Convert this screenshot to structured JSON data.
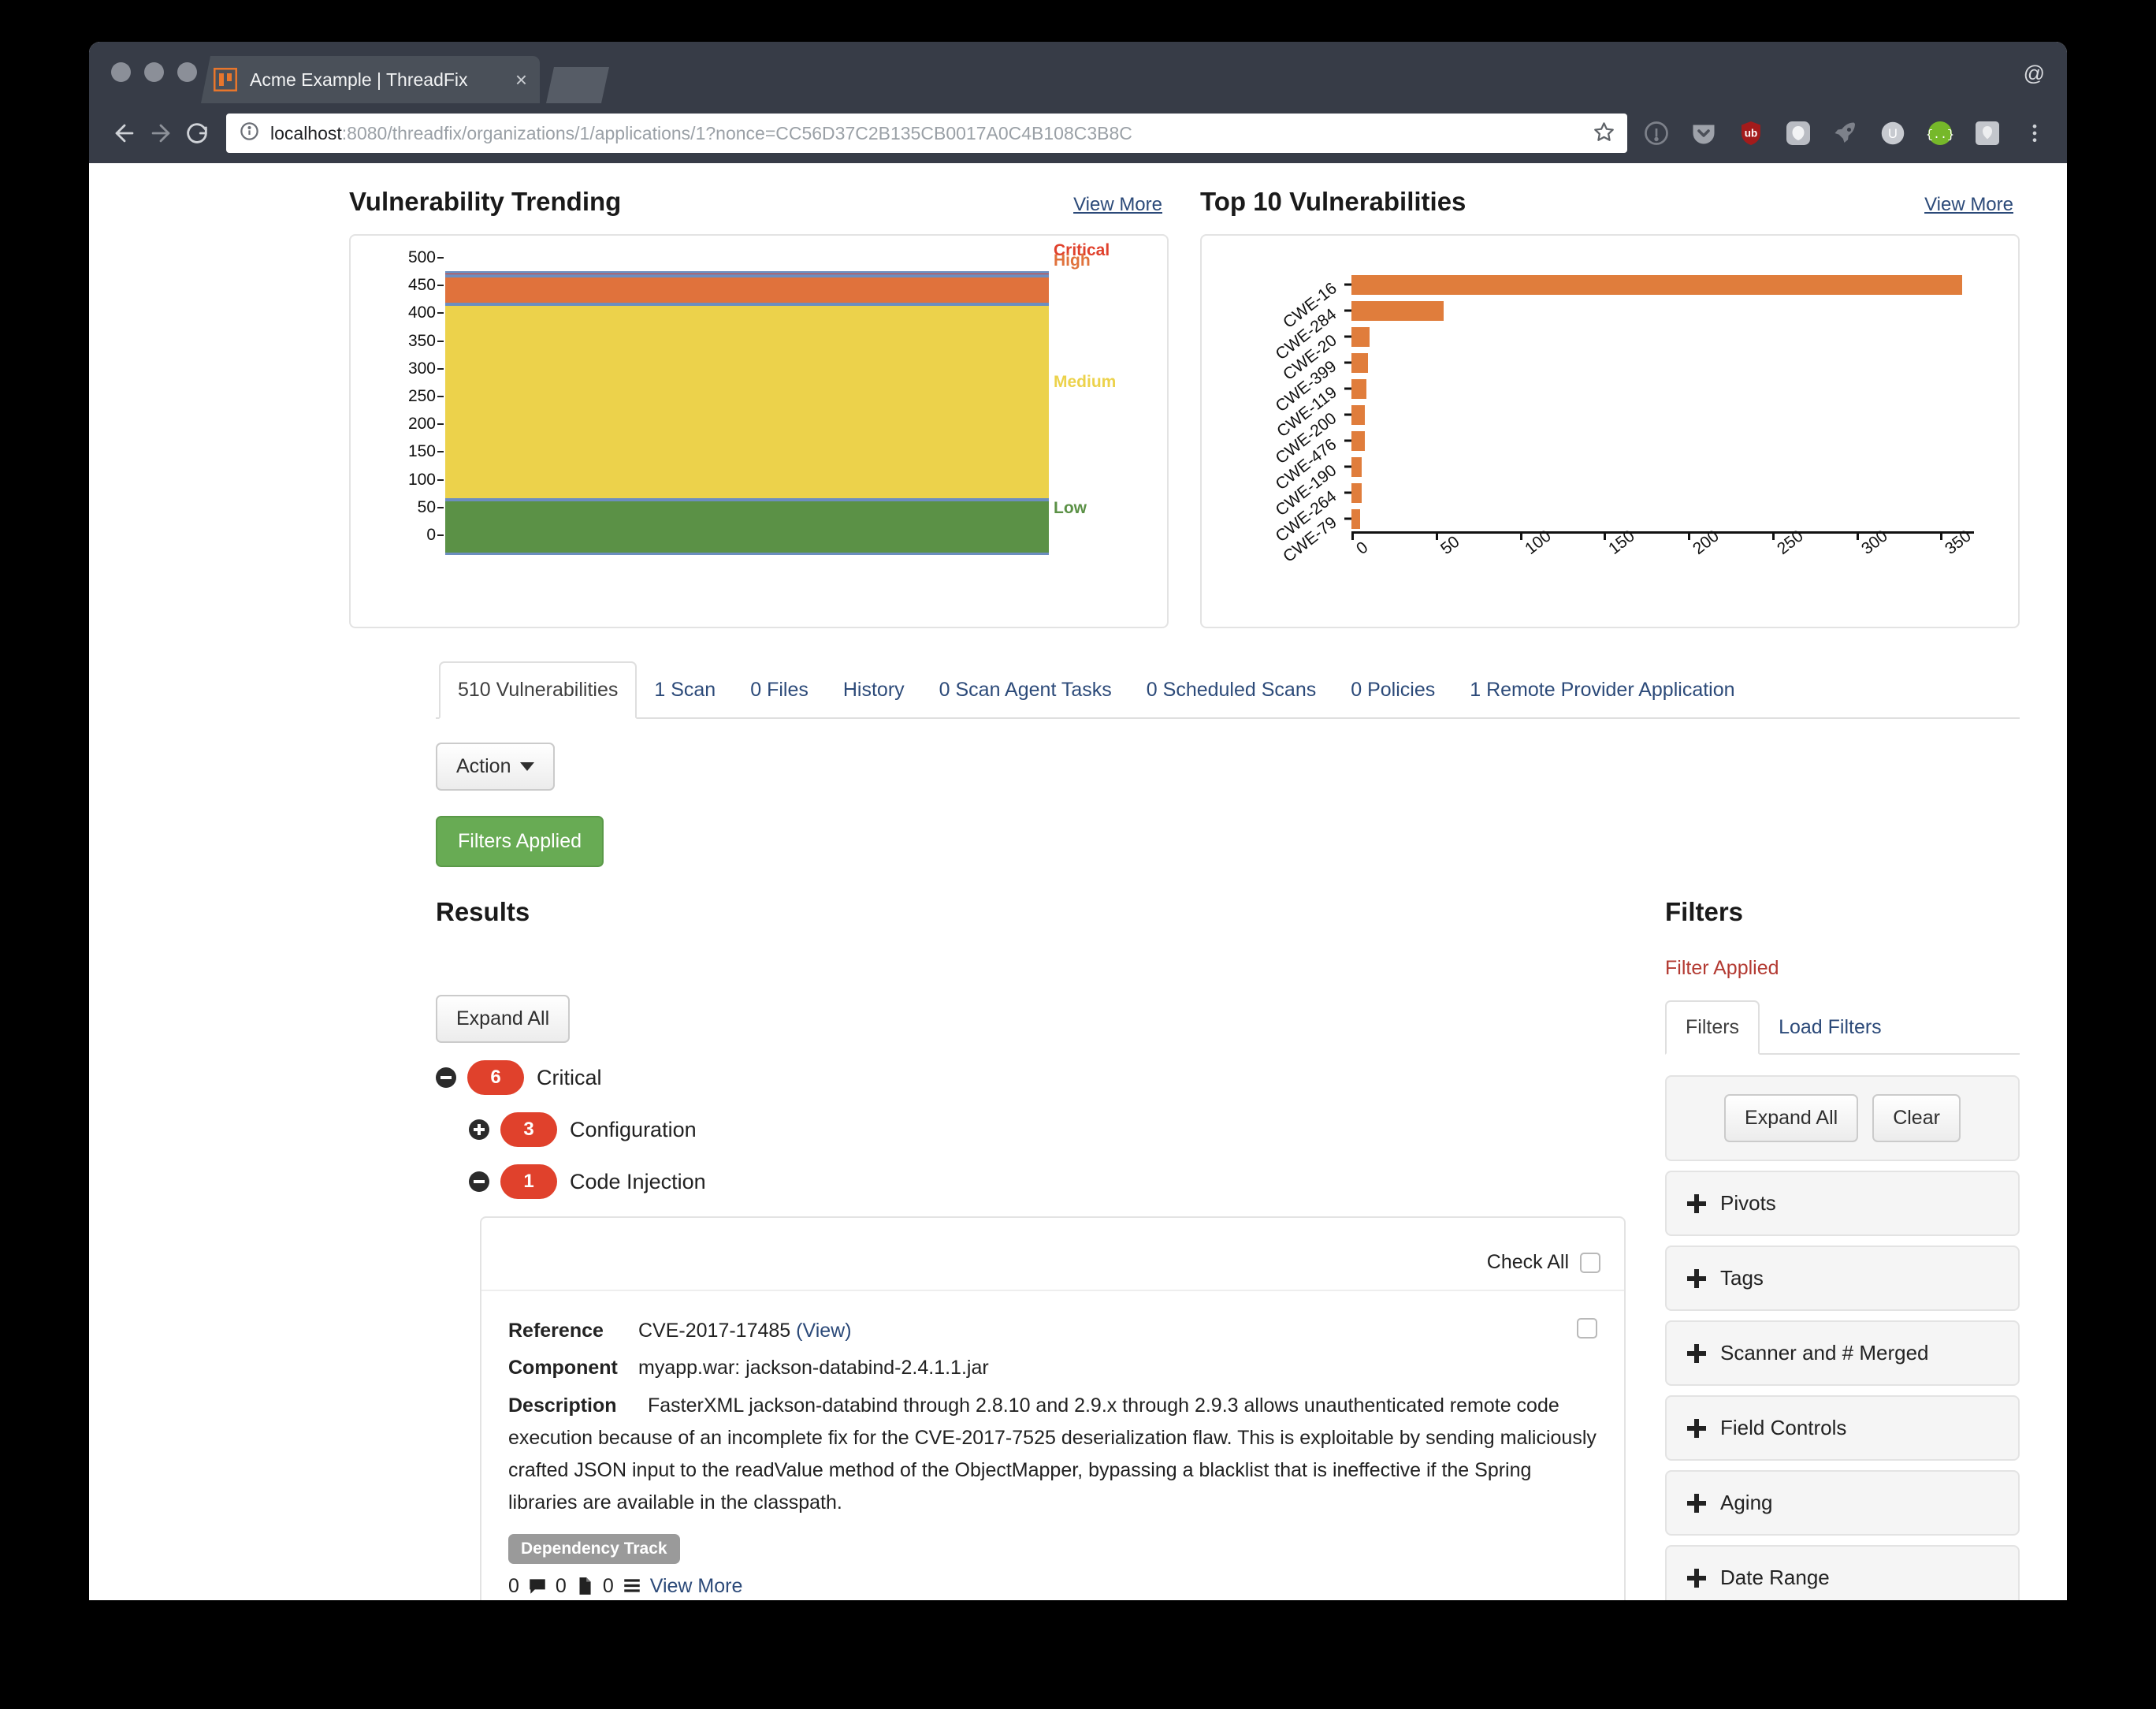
{
  "browser": {
    "tab_title": "Acme Example | ThreadFix",
    "tab_close": "×",
    "profile_icon": "@",
    "url_host": "localhost",
    "url_rest": ":8080/threadfix/organizations/1/applications/1?nonce=CC56D37C2B135CB0017A0C4B108C3B8C",
    "back_icon": "←",
    "forward_icon": "→",
    "reload_icon": "⟳",
    "extensions": [
      "info-circle-icon",
      "pocket-icon",
      "ublock-origin-icon",
      "privacy-badger-icon",
      "rocket-icon",
      "u-circle-icon",
      "json-viewer-icon",
      "user-agent-icon",
      "chrome-menu-icon"
    ]
  },
  "trending": {
    "title": "Vulnerability Trending",
    "view_more": "View More"
  },
  "top10": {
    "title": "Top 10 Vulnerabilities",
    "view_more": "View More"
  },
  "chart_data": [
    {
      "type": "area",
      "title": "Vulnerability Trending",
      "xlabel": "",
      "ylabel": "",
      "ylim": [
        0,
        520
      ],
      "yticks": [
        0,
        50,
        100,
        150,
        200,
        250,
        300,
        350,
        400,
        450,
        500
      ],
      "grid": false,
      "legend_position": "right",
      "stacked": true,
      "series": [
        {
          "name": "Low",
          "color": "#5b9146",
          "value": 98,
          "y_from": 0,
          "y_to": 98
        },
        {
          "name": "Medium",
          "color": "#ecd24b",
          "value": 352,
          "y_from": 98,
          "y_to": 450
        },
        {
          "name": "High",
          "color": "#e0723c",
          "value": 52,
          "y_from": 450,
          "y_to": 502
        },
        {
          "name": "Critical",
          "color": "#e0412c",
          "value": 6,
          "y_from": 502,
          "y_to": 508
        }
      ]
    },
    {
      "type": "bar",
      "orientation": "horizontal",
      "title": "Top 10 Vulnerabilities",
      "xlabel": "",
      "ylabel": "",
      "xlim": [
        0,
        370
      ],
      "xticks": [
        0,
        50,
        100,
        150,
        200,
        250,
        300,
        350
      ],
      "grid": false,
      "bar_color": "#e07d3c",
      "categories": [
        "CWE-16",
        "CWE-284",
        "CWE-20",
        "CWE-399",
        "CWE-119",
        "CWE-200",
        "CWE-476",
        "CWE-190",
        "CWE-264",
        "CWE-79"
      ],
      "values": [
        363,
        55,
        11,
        10,
        9,
        8,
        8,
        6,
        6,
        5
      ]
    }
  ],
  "tabs": [
    {
      "label": "510 Vulnerabilities",
      "active": true
    },
    {
      "label": "1 Scan",
      "active": false
    },
    {
      "label": "0 Files",
      "active": false
    },
    {
      "label": "History",
      "active": false
    },
    {
      "label": "0 Scan Agent Tasks",
      "active": false
    },
    {
      "label": "0 Scheduled Scans",
      "active": false
    },
    {
      "label": "0 Policies",
      "active": false
    },
    {
      "label": "1 Remote Provider Application",
      "active": false
    }
  ],
  "toolbar": {
    "action_label": "Action",
    "filters_applied_label": "Filters Applied"
  },
  "results": {
    "heading": "Results",
    "expand_all_label": "Expand All",
    "tree": [
      {
        "count": "6",
        "label": "Critical",
        "state": "expanded",
        "level": 1
      },
      {
        "count": "3",
        "label": "Configuration",
        "state": "collapsed",
        "level": 2
      },
      {
        "count": "1",
        "label": "Code Injection",
        "state": "expanded",
        "level": 2
      }
    ],
    "card": {
      "check_all_label": "Check All",
      "reference_label": "Reference",
      "reference_value": "CVE-2017-17485",
      "reference_link": "(View)",
      "component_label": "Component",
      "component_value": "myapp.war: jackson-databind-2.4.1.1.jar",
      "description_label": "Description",
      "description_value": "FasterXML jackson-databind through 2.8.10 and 2.9.x through 2.9.3 allows unauthenticated remote code execution because of an incomplete fix for the CVE-2017-7525 deserialization flaw. This is exploitable by sending maliciously crafted JSON input to the readValue method of the ObjectMapper, bypassing a blacklist that is ineffective if the Spring libraries are available in the classpath.",
      "tag": "Dependency Track",
      "comment_count": "0",
      "file_count": "0",
      "list_count": "0",
      "view_more": "View More"
    }
  },
  "filters": {
    "heading": "Filters",
    "applied_note": "Filter Applied",
    "tabs": [
      {
        "label": "Filters",
        "active": true
      },
      {
        "label": "Load Filters",
        "active": false
      }
    ],
    "expand_all_label": "Expand All",
    "clear_label": "Clear",
    "sections": [
      "Pivots",
      "Tags",
      "Scanner and # Merged",
      "Field Controls",
      "Aging",
      "Date Range"
    ]
  },
  "colors": {
    "critical": "#e0412c",
    "high": "#e0723c",
    "medium": "#ecd24b",
    "low": "#5b9146",
    "accent_link": "#2c4a79",
    "success": "#68ab54",
    "danger_text": "#b33a32"
  }
}
